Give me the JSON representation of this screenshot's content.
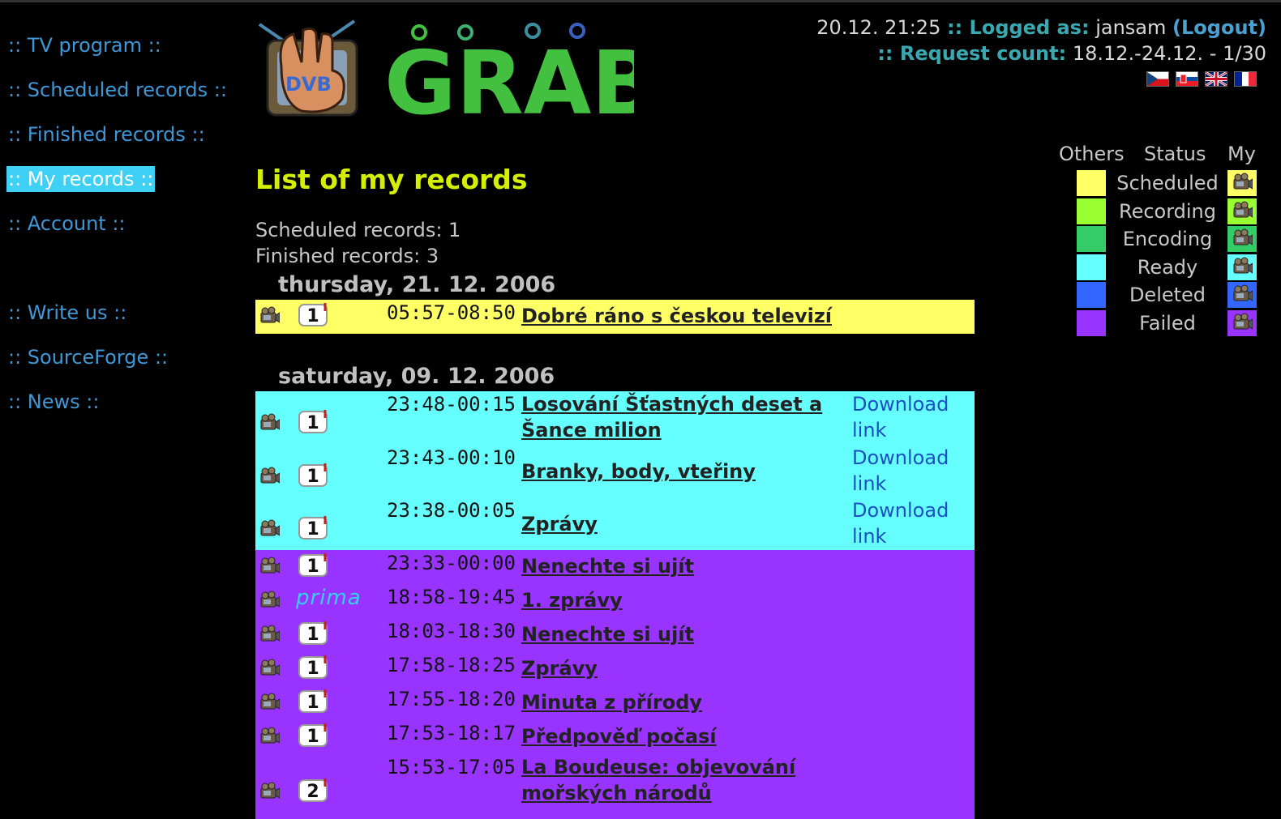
{
  "nav": {
    "tv_program": ":: TV program ::",
    "scheduled": ":: Scheduled records ::",
    "finished": ":: Finished records ::",
    "my_records": ":: My records ::",
    "account": ":: Account ::",
    "write_us": ":: Write us ::",
    "sourceforge": ":: SourceForge ::",
    "news": ":: News ::"
  },
  "logo": {
    "tv_text": "DVB",
    "brand_text": "GRAB"
  },
  "header": {
    "datetime": "20.12. 21:25",
    "logged_label": ":: Logged as:",
    "username": "jansam",
    "logout": "(Logout)",
    "request_label": ":: Request count:",
    "request_value": "18.12.-24.12. - 1/30",
    "flags": [
      "cz-flag-icon",
      "sk-flag-icon",
      "gb-flag-icon",
      "fr-flag-icon"
    ]
  },
  "legend": {
    "others_header": "Others",
    "status_header": "Status",
    "my_header": "My",
    "items": [
      {
        "label": "Scheduled",
        "color": "#ffff66"
      },
      {
        "label": "Recording",
        "color": "#99ff33"
      },
      {
        "label": "Encoding",
        "color": "#33cc66"
      },
      {
        "label": "Ready",
        "color": "#66ffff"
      },
      {
        "label": "Deleted",
        "color": "#3366ff"
      },
      {
        "label": "Failed",
        "color": "#9933ff"
      }
    ]
  },
  "main": {
    "title": "List of my records",
    "scheduled_count": "Scheduled records: 1",
    "finished_count": "Finished records: 3",
    "days": [
      {
        "date": "thursday, 21. 12. 2006",
        "records": [
          {
            "channel": "1",
            "time": "05:57-08:50",
            "title": "Dobré ráno s českou televizí",
            "status": "Scheduled"
          }
        ]
      },
      {
        "date": "saturday, 09. 12. 2006",
        "records": [
          {
            "channel": "1",
            "time": "23:48-00:15",
            "title_l1": "Losování Šťastných deset a",
            "title_l2": "Šance milion",
            "dl1": "Download",
            "dl2": "link",
            "status": "Ready"
          },
          {
            "channel": "1",
            "time": "23:43-00:10",
            "title": "Branky, body, vteřiny",
            "dl1": "Download",
            "dl2": "link",
            "status": "Ready"
          },
          {
            "channel": "1",
            "time": "23:38-00:05",
            "title": "Zprávy",
            "dl1": "Download",
            "dl2": "link",
            "status": "Ready"
          },
          {
            "channel": "1",
            "time": "23:33-00:00",
            "title": "Nenechte si ujít",
            "status": "Failed"
          },
          {
            "channel": "prima",
            "time": "18:58-19:45",
            "title": "1. zprávy",
            "status": "Failed"
          },
          {
            "channel": "1",
            "time": "18:03-18:30",
            "title": "Nenechte si ujít",
            "status": "Failed"
          },
          {
            "channel": "1",
            "time": "17:58-18:25",
            "title": "Zprávy",
            "status": "Failed"
          },
          {
            "channel": "1",
            "time": "17:55-18:20",
            "title": "Minuta z přírody",
            "status": "Failed"
          },
          {
            "channel": "1",
            "time": "17:53-18:17",
            "title": "Předpověď počasí",
            "status": "Failed"
          },
          {
            "channel": "2",
            "time": "15:53-17:05",
            "title_l1": "La Boudeuse: objevování",
            "title_l2": "mořských národů",
            "status": "Failed"
          }
        ]
      }
    ]
  }
}
